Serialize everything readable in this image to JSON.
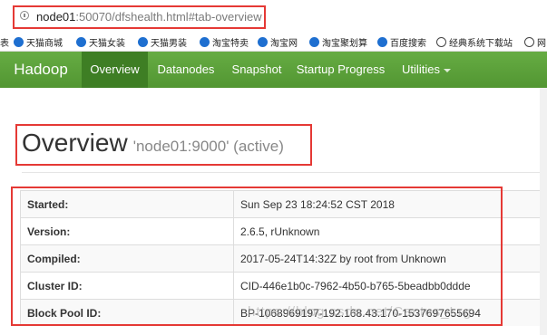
{
  "browser": {
    "url_host": "node01",
    "url_rest": ":50070/dfshealth.html#tab-overview",
    "bookmarks": [
      "天猫商城",
      "天猫女装",
      "天猫男装",
      "淘宝特卖",
      "淘宝网",
      "淘宝聚划算",
      "百度搜索",
      "经典系统下载站",
      "网"
    ]
  },
  "nav": {
    "brand": "Hadoop",
    "items": [
      "Overview",
      "Datanodes",
      "Snapshot",
      "Startup Progress",
      "Utilities"
    ]
  },
  "header": {
    "title": "Overview",
    "subtitle": "'node01:9000' (active)"
  },
  "rows": [
    {
      "key": "Started:",
      "value": "Sun Sep 23 18:24:52 CST 2018"
    },
    {
      "key": "Version:",
      "value": "2.6.5, rUnknown"
    },
    {
      "key": "Compiled:",
      "value": "2017-05-24T14:32Z by root from Unknown"
    },
    {
      "key": "Cluster ID:",
      "value": "CID-446e1b0c-7962-4b50-b765-5beadbb0ddde"
    },
    {
      "key": "Block Pool ID:",
      "value": "BP-1068969197-192.168.43.170-1537697655694"
    }
  ],
  "watermark": "https://blog.csdn.net/Cactus_Lrg"
}
